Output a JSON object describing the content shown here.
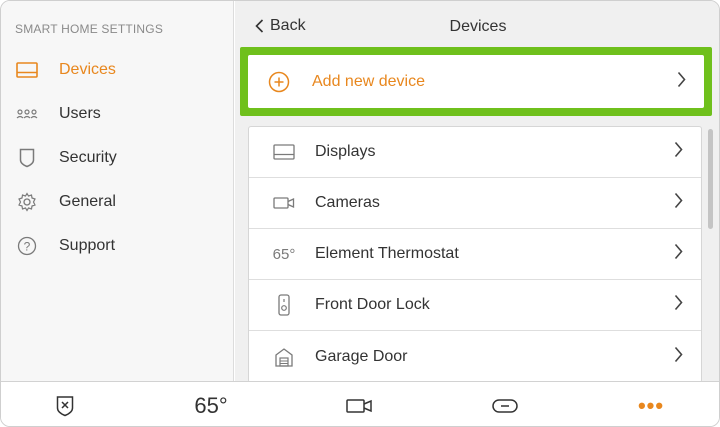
{
  "sidebar": {
    "heading": "SMART HOME SETTINGS",
    "items": [
      {
        "label": "Devices",
        "icon": "display-icon",
        "active": true
      },
      {
        "label": "Users",
        "icon": "users-icon"
      },
      {
        "label": "Security",
        "icon": "shield-icon"
      },
      {
        "label": "General",
        "icon": "gear-icon"
      },
      {
        "label": "Support",
        "icon": "help-icon"
      }
    ]
  },
  "header": {
    "back_label": "Back",
    "title": "Devices"
  },
  "add_device": {
    "label": "Add new device"
  },
  "devices": [
    {
      "label": "Displays",
      "icon": "display-icon"
    },
    {
      "label": "Cameras",
      "icon": "camera-icon"
    },
    {
      "label": "Element Thermostat",
      "icon_text": "65°"
    },
    {
      "label": "Front Door Lock",
      "icon": "lock-icon"
    },
    {
      "label": "Garage Door",
      "icon": "garage-icon"
    }
  ],
  "bottombar": {
    "temperature": "65°",
    "more": "•••"
  },
  "colors": {
    "accent": "#e8871e",
    "highlight": "#6fc01c"
  }
}
